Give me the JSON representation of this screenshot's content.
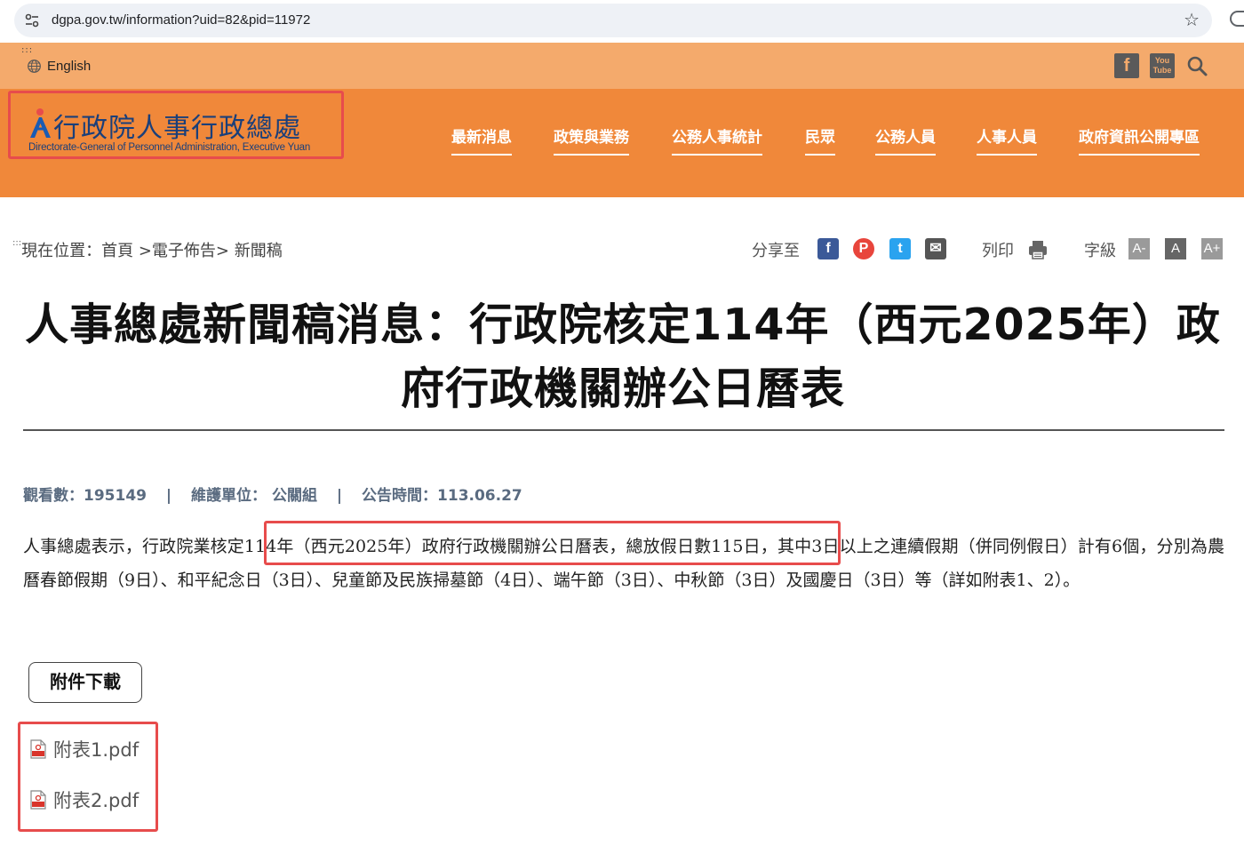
{
  "browser": {
    "url": "dgpa.gov.tw/information?uid=82&pid=11972"
  },
  "header": {
    "language_link": "English",
    "logo_title": "行政院人事行政總處",
    "logo_subtitle": "Directorate-General of Personnel Administration, Executive Yuan",
    "social_icons": [
      "facebook-icon",
      "youtube-icon",
      "search-icon"
    ],
    "facebook_glyph": "f",
    "youtube_glyph": "You Tube",
    "nav": [
      {
        "label": "最新消息"
      },
      {
        "label": "政策與業務"
      },
      {
        "label": "公務人事統計"
      },
      {
        "label": "民眾"
      },
      {
        "label": "公務人員"
      },
      {
        "label": "人事人員"
      },
      {
        "label": "政府資訊公開專區"
      }
    ]
  },
  "breadcrumb": {
    "prefix": ":::",
    "text": "現在位置：首頁 >電子佈告> 新聞稿"
  },
  "tools": {
    "share_label": "分享至",
    "print_label": "列印",
    "font_label": "字級",
    "share_glyphs": {
      "facebook": "f",
      "plurk": "P",
      "twitter": "t",
      "email": "✉"
    },
    "font_sizes": [
      "A-",
      "A",
      "A+"
    ],
    "colors": {
      "facebook": "#3b5998",
      "plurk": "#e8453c",
      "twitter": "#2aa3ef",
      "email": "#555555"
    }
  },
  "article": {
    "title_line1": "人事總處新聞稿消息：行政院核定114年（西元2025年）政",
    "title_line2": "府行政機關辦公日曆表",
    "meta": {
      "views_label": "觀看數：",
      "views": "195149",
      "unit_label": "維護單位：",
      "unit": "公關組",
      "date_label": "公告時間：",
      "date": "113.06.27",
      "separator": "|"
    },
    "body": "人事總處表示，行政院業核定114年（西元2025年）政府行政機關辦公日曆表，總放假日數115日，其中3日以上之連續假期（併同例假日）計有6個，分別為農曆春節假期（9日）、和平紀念日（3日）、兒童節及民族掃墓節（4日）、端午節（3日）、中秋節（3日）及國慶日（3日）等（詳如附表1、2）。",
    "attachments_button": "附件下載",
    "attachments": [
      {
        "name": "附表1.pdf"
      },
      {
        "name": "附表2.pdf"
      }
    ]
  },
  "colors": {
    "header_light": "#f4aa6c",
    "header_main": "#f0883a",
    "logo_blue": "#1a3f7a",
    "annotation_red": "#e74c4c"
  }
}
